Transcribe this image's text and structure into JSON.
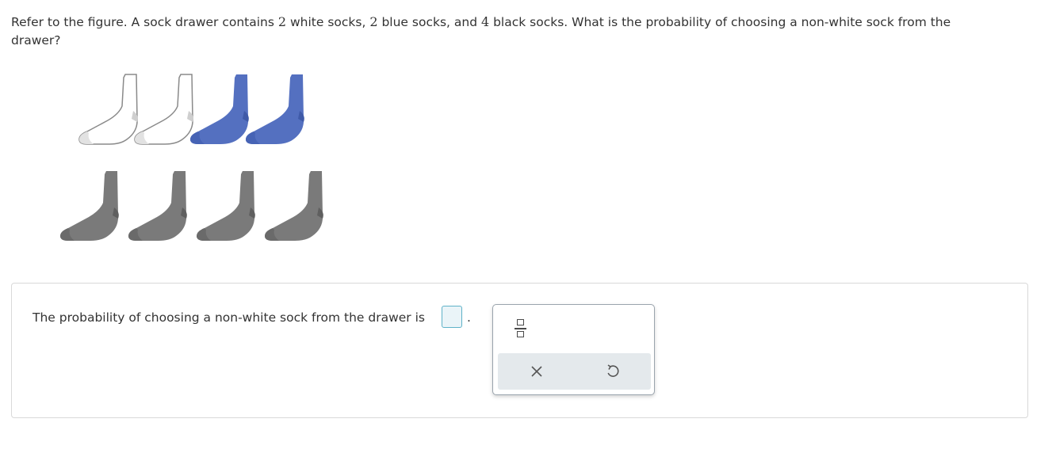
{
  "question": {
    "part1": "Refer to the figure. A sock drawer contains ",
    "n_white": "2",
    "part2": " white socks, ",
    "n_blue": "2",
    "part3": " blue socks, and ",
    "n_black": "4",
    "part4": " black socks. What is the probability of choosing a non-white sock from the drawer?"
  },
  "figure": {
    "rows": [
      [
        "white",
        "white",
        "blue",
        "blue"
      ],
      [
        "black",
        "black",
        "black",
        "black"
      ]
    ],
    "colors": {
      "white": "#ffffff",
      "blue": "#5470c0",
      "black": "#7a7a7a",
      "outline": "#8a8a8a"
    }
  },
  "answer": {
    "prompt": "The probability of choosing a non-white sock from the drawer is",
    "input_value": "",
    "suffix": "."
  },
  "toolbar": {
    "fraction_icon": "fraction-icon",
    "clear_icon": "x-icon",
    "undo_icon": "undo-icon"
  }
}
